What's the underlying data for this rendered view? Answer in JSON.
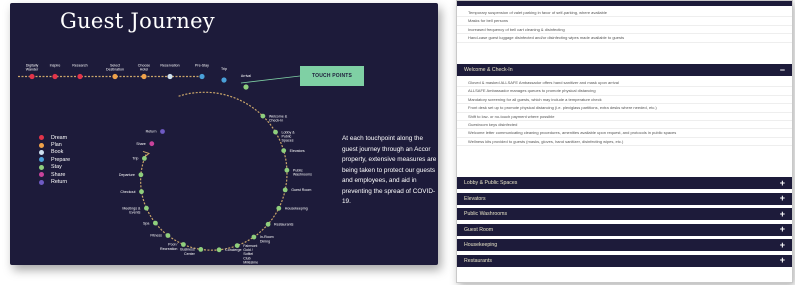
{
  "journey": {
    "title": "Guest Journey",
    "touch_points_label": "TOUCH POINTS",
    "description": "At each touchpoint along the guest journey through an Accor property, extensive measures are being taken to protect our guests and employees, and aid in preventing the spread of COVID-19.",
    "legend": [
      {
        "label": "Dream",
        "color": "#e3344a"
      },
      {
        "label": "Plan",
        "color": "#f0a24a"
      },
      {
        "label": "Book",
        "color": "#cfe1ef"
      },
      {
        "label": "Prepare",
        "color": "#4aa0d8"
      },
      {
        "label": "Stay",
        "color": "#8fcf7d"
      },
      {
        "label": "Share",
        "color": "#c9439b"
      },
      {
        "label": "Return",
        "color": "#6f5bc4"
      }
    ],
    "top_stops": [
      "Digitally Wander",
      "Inspire",
      "Research",
      "Select Destination",
      "Choose Hotel",
      "Reservation",
      "Pre-Stay",
      "Trip",
      "Arrival"
    ],
    "circle_stops": [
      "Welcome & Check-In",
      "Lobby & Public Spaces",
      "Elevators",
      "Public Washrooms",
      "Guest Room",
      "Housekeeping",
      "Restaurants",
      "In-Room Dining",
      "Fairmont Gold / Sofitel Club Millésime",
      "Concierge",
      "Business Center",
      "Pool / Recreation",
      "Fitness",
      "Spa",
      "Meetings & Events",
      "Checkout",
      "Departure",
      "Trip",
      "Share",
      "Return"
    ],
    "colors": {
      "background": "#1d1b3a",
      "accent": "#7fd0a4",
      "line": "#c9a56a"
    }
  },
  "accordion": {
    "top_items": [
      "Temporary suspension of valet parking in favor of self-parking, where available",
      "Masks for bell persons",
      "Increased frequency of bell cart cleaning & disinfecting",
      "Hand-case guest luggage disinfected and/or disinfecting wipes made available to guests"
    ],
    "welcome": {
      "label": "Welcome & Check-In",
      "toggle": "−",
      "items": [
        "Gloved & masked ALLSAFE Ambassador offers hand sanitizer and mask upon arrival",
        "ALLSAFE Ambassador manages queues to promote physical distancing",
        "Mandatory screening for all guests, which may include a temperature check",
        "Front desk set up to promote physical distancing (i.e. plexiglass partitions, extra desks where needed, etc.)",
        "Shift to low- or no-touch payment where possible",
        "Guestroom keys disinfected",
        "Welcome letter communicating cleaning procedures, amenities available upon request, and protocols in public spaces",
        "Wellness kits provided to guests (masks, gloves, hand sanitizer, disinfecting wipes, etc.)"
      ]
    },
    "sections": [
      {
        "label": "Lobby & Public Spaces",
        "toggle": "+"
      },
      {
        "label": "Elevators",
        "toggle": "+"
      },
      {
        "label": "Public Washrooms",
        "toggle": "+"
      },
      {
        "label": "Guest Room",
        "toggle": "+"
      },
      {
        "label": "Housekeeping",
        "toggle": "+"
      },
      {
        "label": "Restaurants",
        "toggle": "+"
      }
    ]
  }
}
